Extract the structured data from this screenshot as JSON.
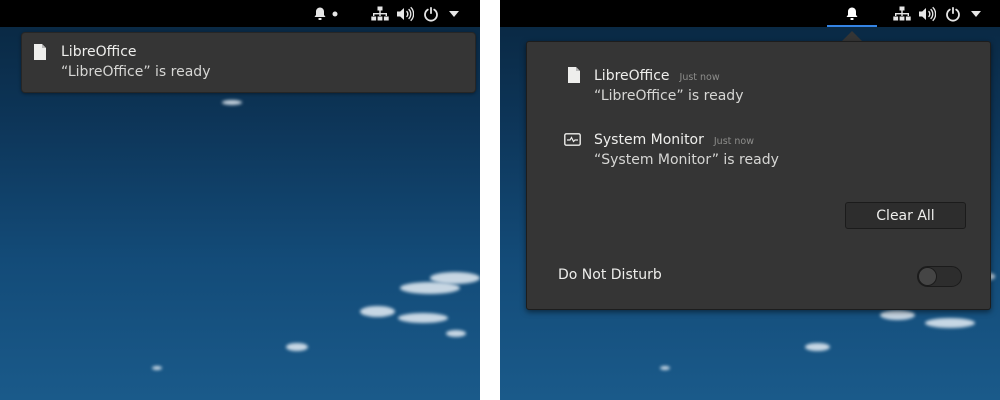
{
  "left": {
    "tray": {
      "bell_icon": "bell-icon",
      "indicator": "unread-dot",
      "network_icon": "network-icon",
      "volume_icon": "volume-icon",
      "power_icon": "power-icon",
      "menu_icon": "chevron-down-icon"
    },
    "banner": {
      "icon": "document-icon",
      "title": "LibreOffice",
      "body": "“LibreOffice” is ready"
    }
  },
  "right": {
    "tray": {
      "bell_icon": "bell-icon",
      "network_icon": "network-icon",
      "volume_icon": "volume-icon",
      "power_icon": "power-icon",
      "menu_icon": "chevron-down-icon",
      "accent": "#3584e4"
    },
    "notifications": [
      {
        "icon": "document-icon",
        "title": "LibreOffice",
        "time": "Just now",
        "body": "“LibreOffice” is ready"
      },
      {
        "icon": "system-monitor-icon",
        "title": "System Monitor",
        "time": "Just now",
        "body": "“System Monitor” is ready"
      }
    ],
    "clear_all_label": "Clear All",
    "dnd_label": "Do Not Disturb",
    "dnd_enabled": false
  }
}
